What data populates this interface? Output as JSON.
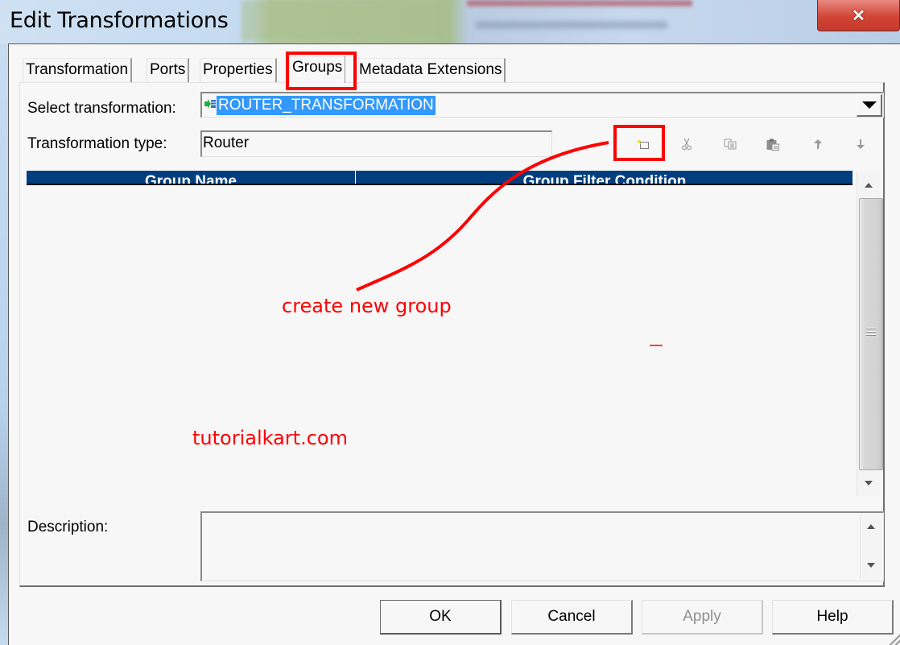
{
  "window": {
    "title": "Edit Transformations",
    "close_icon": "close-icon"
  },
  "tabs": [
    {
      "label": "Transformation",
      "active": false
    },
    {
      "label": "Ports",
      "active": false
    },
    {
      "label": "Properties",
      "active": false
    },
    {
      "label": "Groups",
      "active": true
    },
    {
      "label": "Metadata Extensions",
      "active": false
    }
  ],
  "form": {
    "select_transformation_label": "Select transformation:",
    "select_transformation_value": "ROUTER_TRANSFORMATION",
    "select_transformation_icon": "router-transformation-icon",
    "transformation_type_label": "Transformation type:",
    "transformation_type_value": "Router",
    "description_label": "Description:",
    "description_value": ""
  },
  "toolbar": [
    {
      "name": "new-group-button",
      "icon": "new-item-icon",
      "enabled": true
    },
    {
      "name": "cut-button",
      "icon": "scissors-icon",
      "enabled": false
    },
    {
      "name": "copy-button",
      "icon": "copy-icon",
      "enabled": false
    },
    {
      "name": "paste-button",
      "icon": "paste-icon",
      "enabled": false
    },
    {
      "name": "move-up-button",
      "icon": "arrow-up-icon",
      "enabled": false
    },
    {
      "name": "move-down-button",
      "icon": "arrow-down-icon",
      "enabled": false
    }
  ],
  "grid": {
    "columns": [
      "Group Name",
      "Group Filter Condition"
    ],
    "rows": []
  },
  "buttons": {
    "ok": "OK",
    "cancel": "Cancel",
    "apply": "Apply",
    "help": "Help"
  },
  "annotations": {
    "callout": "create new group",
    "watermark": "tutorialkart.com",
    "color": "#ff0000"
  },
  "colors": {
    "grid_header": "#003f7f",
    "selection": "#3399ff",
    "dialog_bg": "#f7f7f7"
  }
}
